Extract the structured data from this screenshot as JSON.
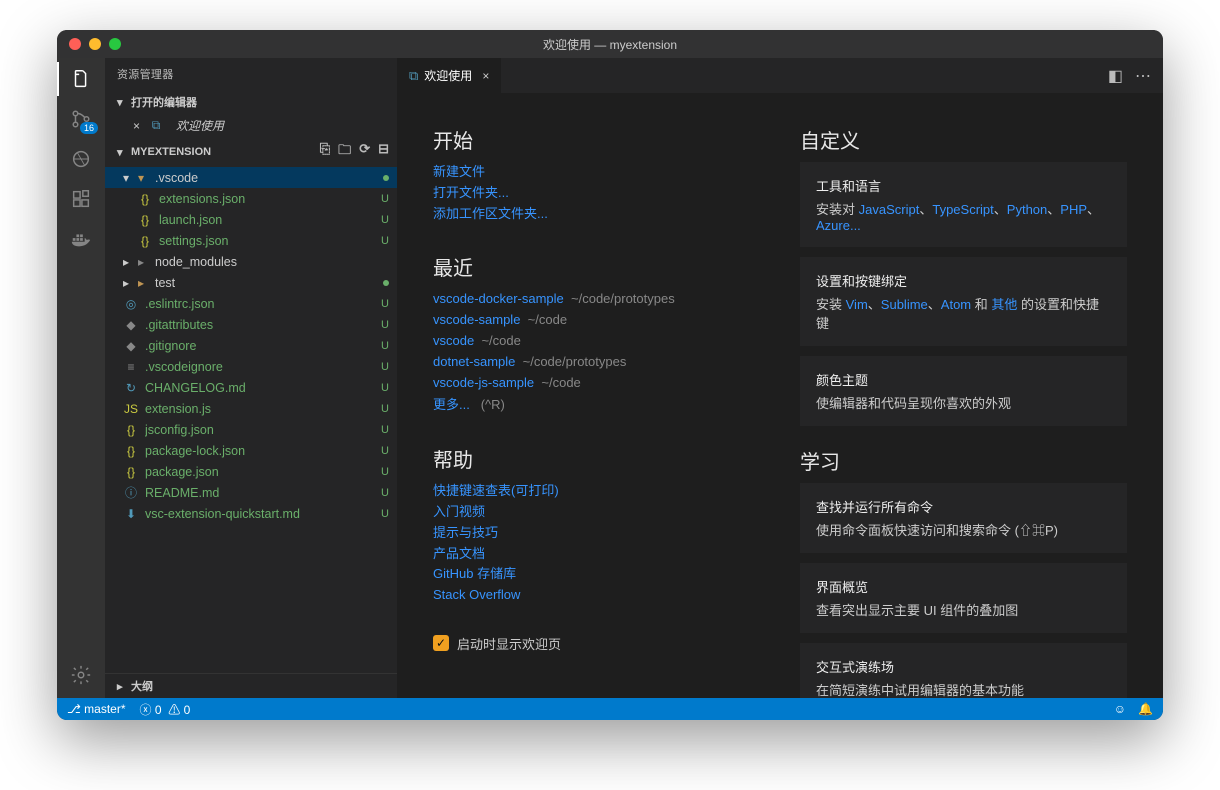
{
  "window_title": "欢迎使用 — myextension",
  "activitybar": {
    "badge_scm": "16"
  },
  "sidebar": {
    "title": "资源管理器",
    "open_editors_label": "打开的编辑器",
    "open_editor_item": "欢迎使用",
    "folder_label": "MYEXTENSION",
    "outline_label": "大纲",
    "tree": [
      {
        "name": ".vscode",
        "type": "folder",
        "depth": 0,
        "selected": true,
        "expanded": true,
        "status": "●"
      },
      {
        "name": "extensions.json",
        "type": "json",
        "depth": 1,
        "status": "U"
      },
      {
        "name": "launch.json",
        "type": "json",
        "depth": 1,
        "status": "U"
      },
      {
        "name": "settings.json",
        "type": "json",
        "depth": 1,
        "status": "U"
      },
      {
        "name": "node_modules",
        "type": "folder-grey",
        "depth": 0,
        "expanded": false
      },
      {
        "name": "test",
        "type": "folder-green",
        "depth": 0,
        "expanded": false,
        "status": "●"
      },
      {
        "name": ".eslintrc.json",
        "type": "eslint",
        "depth": 0,
        "status": "U"
      },
      {
        "name": ".gitattributes",
        "type": "git-grey",
        "depth": 0,
        "status": "U"
      },
      {
        "name": ".gitignore",
        "type": "git-grey",
        "depth": 0,
        "status": "U"
      },
      {
        "name": ".vscodeignore",
        "type": "text",
        "depth": 0,
        "status": "U"
      },
      {
        "name": "CHANGELOG.md",
        "type": "md",
        "depth": 0,
        "status": "U"
      },
      {
        "name": "extension.js",
        "type": "js",
        "depth": 0,
        "status": "U"
      },
      {
        "name": "jsconfig.json",
        "type": "json",
        "depth": 0,
        "status": "U"
      },
      {
        "name": "package-lock.json",
        "type": "json",
        "depth": 0,
        "status": "U"
      },
      {
        "name": "package.json",
        "type": "json",
        "depth": 0,
        "status": "U"
      },
      {
        "name": "README.md",
        "type": "info",
        "depth": 0,
        "status": "U"
      },
      {
        "name": "vsc-extension-quickstart.md",
        "type": "dl",
        "depth": 0,
        "status": "U"
      }
    ]
  },
  "tab": {
    "label": "欢迎使用"
  },
  "welcome": {
    "start_h": "开始",
    "start_links": [
      "新建文件",
      "打开文件夹...",
      "添加工作区文件夹..."
    ],
    "recent_h": "最近",
    "recent": [
      {
        "name": "vscode-docker-sample",
        "path": "~/code/prototypes"
      },
      {
        "name": "vscode-sample",
        "path": "~/code"
      },
      {
        "name": "vscode",
        "path": "~/code"
      },
      {
        "name": "dotnet-sample",
        "path": "~/code/prototypes"
      },
      {
        "name": "vscode-js-sample",
        "path": "~/code"
      }
    ],
    "more_label": "更多...",
    "more_hint": "(^R)",
    "help_h": "帮助",
    "help_links": [
      "快捷键速查表(可打印)",
      "入门视频",
      "提示与技巧",
      "产品文档",
      "GitHub 存储库",
      "Stack Overflow"
    ],
    "show_welcome": "启动时显示欢迎页",
    "custom_h": "自定义",
    "card_tools_title": "工具和语言",
    "card_tools_prefix": "安装对 ",
    "card_tools_links": [
      "JavaScript",
      "TypeScript",
      "Python",
      "PHP",
      "Azure..."
    ],
    "card_keys_title": "设置和按键绑定",
    "card_keys_prefix": "安装 ",
    "card_keys_links": [
      "Vim",
      "Sublime",
      "Atom"
    ],
    "card_keys_mid": " 和 ",
    "card_keys_other": "其他",
    "card_keys_suffix": " 的设置和快捷键",
    "card_theme_title": "颜色主题",
    "card_theme_desc": "使编辑器和代码呈现你喜欢的外观",
    "learn_h": "学习",
    "card_cmd_title": "查找并运行所有命令",
    "card_cmd_desc": "使用命令面板快速访问和搜索命令 (⇧⌘P)",
    "card_ui_title": "界面概览",
    "card_ui_desc": "查看突出显示主要 UI 组件的叠加图",
    "card_play_title": "交互式演练场",
    "card_play_desc": "在简短演练中试用编辑器的基本功能"
  },
  "statusbar": {
    "branch": "master*",
    "errors": "0",
    "warnings": "0"
  }
}
